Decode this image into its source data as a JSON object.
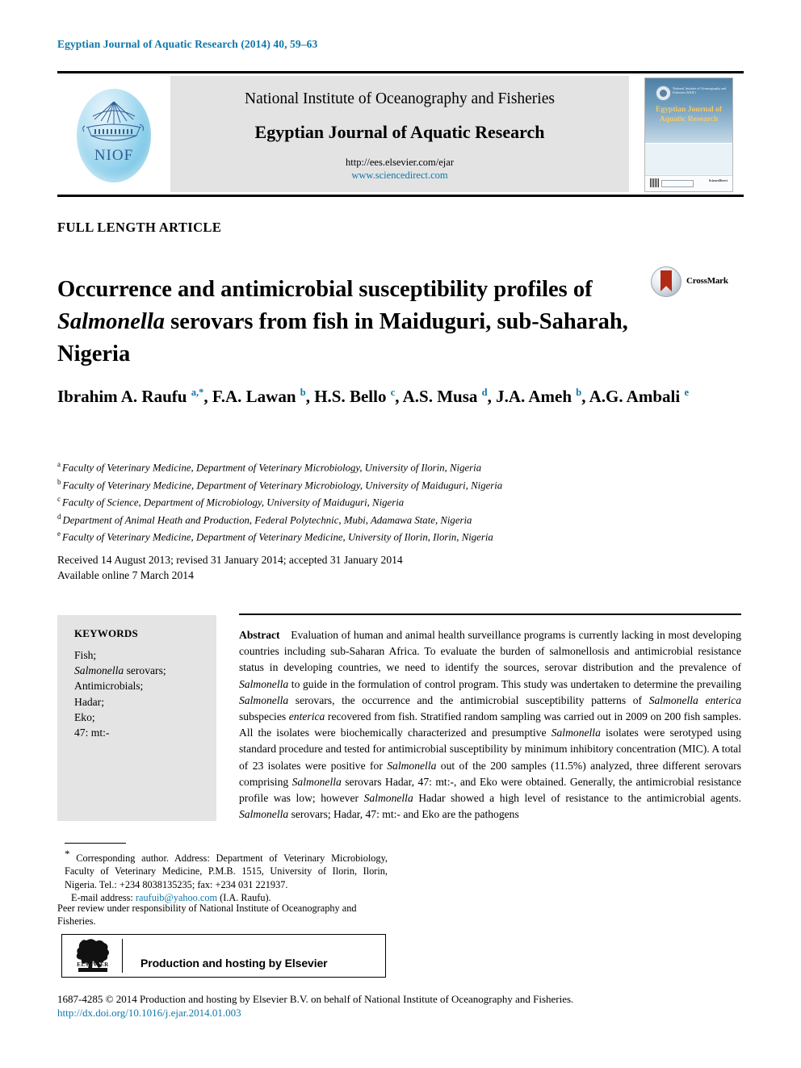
{
  "running_head": "Egyptian Journal of Aquatic Research (2014) 40, 59–63",
  "masthead": {
    "logo_text": "NIOF",
    "institute": "National Institute of Oceanography and Fisheries",
    "journal": "Egyptian Journal of Aquatic Research",
    "url_submission": "http://ees.elsevier.com/ejar",
    "url_sciencedirect": "www.sciencedirect.com",
    "cover": {
      "org_line": "National Institute of Oceanography and Fisheries (NIOF)",
      "title": "Egyptian Journal of Aquatic Research",
      "publisher": "ScienceDirect"
    }
  },
  "article_type": "FULL LENGTH ARTICLE",
  "title_parts": {
    "p1": "Occurrence and antimicrobial susceptibility profiles of ",
    "p2_italic": "Salmonella",
    "p3": " serovars from fish in Maiduguri, sub-Saharah, Nigeria"
  },
  "crossmark": {
    "label": "CrossMark"
  },
  "authors": [
    {
      "name": "Ibrahim A. Raufu",
      "marks": "a,*"
    },
    {
      "name": "F.A. Lawan",
      "marks": "b"
    },
    {
      "name": "H.S. Bello",
      "marks": "c"
    },
    {
      "name": "A.S. Musa",
      "marks": "d"
    },
    {
      "name": "J.A. Ameh",
      "marks": "b"
    },
    {
      "name": "A.G. Ambali",
      "marks": "e"
    }
  ],
  "affiliations": [
    {
      "mark": "a",
      "text": "Faculty of Veterinary Medicine, Department of Veterinary Microbiology, University of Ilorin, Nigeria"
    },
    {
      "mark": "b",
      "text": "Faculty of Veterinary Medicine, Department of Veterinary Microbiology, University of Maiduguri, Nigeria"
    },
    {
      "mark": "c",
      "text": "Faculty of Science, Department of Microbiology, University of Maiduguri, Nigeria"
    },
    {
      "mark": "d",
      "text": "Department of Animal Heath and Production, Federal Polytechnic, Mubi, Adamawa State, Nigeria"
    },
    {
      "mark": "e",
      "text": "Faculty of Veterinary Medicine, Department of Veterinary Medicine, University of Ilorin, Ilorin, Nigeria"
    }
  ],
  "dates": {
    "line1": "Received 14 August 2013; revised 31 January 2014; accepted 31 January 2014",
    "line2": "Available online 7 March 2014"
  },
  "keywords": {
    "heading": "KEYWORDS",
    "items": [
      "Fish;",
      "Salmonella serovars;",
      "Antimicrobials;",
      "Hadar;",
      "Eko;",
      "47: mt:-"
    ]
  },
  "abstract": {
    "label": "Abstract",
    "text": "Evaluation of human and animal health surveillance programs is currently lacking in most developing countries including sub-Saharan Africa. To evaluate the burden of salmonellosis and antimicrobial resistance status in developing countries, we need to identify the sources, serovar distribution and the prevalence of Salmonella to guide in the formulation of control program. This study was undertaken to determine the prevailing Salmonella serovars, the occurrence and the antimicrobial susceptibility patterns of Salmonella enterica subspecies enterica recovered from fish. Stratified random sampling was carried out in 2009 on 200 fish samples. All the isolates were biochemically characterized and presumptive Salmonella isolates were serotyped using standard procedure and tested for antimicrobial susceptibility by minimum inhibitory concentration (MIC). A total of 23 isolates were positive for Salmonella out of the 200 samples (11.5%) analyzed, three different serovars comprising Salmonella serovars Hadar, 47: mt:-, and Eko were obtained. Generally, the antimicrobial resistance profile was low; however Salmonella Hadar showed a high level of resistance to the antimicrobial agents. Salmonella serovars; Hadar, 47: mt:- and Eko are the pathogens"
  },
  "footnote": {
    "corresponding": "Corresponding author. Address: Department of Veterinary Microbiology, Faculty of Veterinary Medicine, P.M.B. 1515, University of Ilorin, Ilorin, Nigeria. Tel.: +234 8038135235; fax: +234 031 221937.",
    "email_label": "E-mail address:",
    "email": "raufuib@yahoo.com",
    "email_owner": "(I.A. Raufu).",
    "peer_review": "Peer review under responsibility of National Institute of Oceanography and Fisheries."
  },
  "production_box": {
    "logo_word": "ELSEVIER",
    "text": "Production and hosting by Elsevier"
  },
  "copyright": "1687-4285 © 2014 Production and hosting by Elsevier B.V. on behalf of National Institute of Oceanography and Fisheries.",
  "doi": "http://dx.doi.org/10.1016/j.ejar.2014.01.003",
  "colors": {
    "accent_blue": "#1077a8",
    "masthead_gray": "#e3e3e3",
    "keyword_gray": "#e4e4e4",
    "crossmark_red": "#b02a16"
  }
}
